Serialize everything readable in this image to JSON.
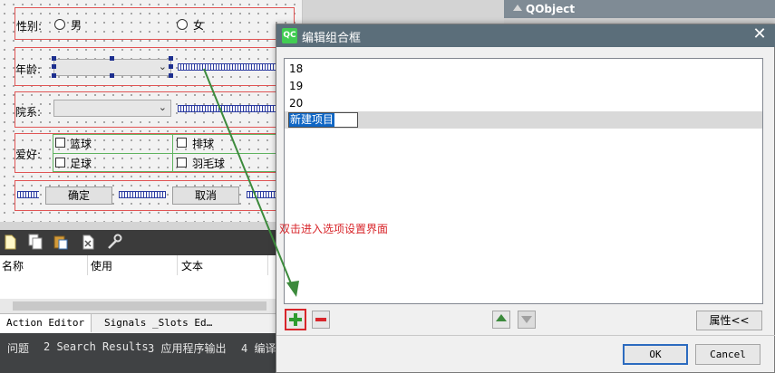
{
  "designer_form": {
    "gender_label": "性别:",
    "gender_male": "男",
    "gender_female": "女",
    "age_label": "年龄:",
    "department_label": "院系:",
    "hobby_label": "爱好:",
    "hobbies": [
      "篮球",
      "排球",
      "足球",
      "羽毛球"
    ],
    "confirm_button": "确定",
    "cancel_button": "取消"
  },
  "right_panel": {
    "object_row": "QObject"
  },
  "action_editor": {
    "columns": [
      "名称",
      "使用",
      "文本"
    ],
    "tabs": [
      "Action Editor",
      "Signals _Slots Ed…"
    ]
  },
  "status_bar": {
    "items": [
      "问题",
      "2 Search Results",
      "3 应用程序输出",
      "4 编译"
    ]
  },
  "dialog": {
    "app_badge": "QC",
    "title": "编辑组合框",
    "items": [
      "18",
      "19",
      "20"
    ],
    "editing_item": "新建项目",
    "properties_button": "属性<<",
    "ok_button": "OK",
    "cancel_button": "Cancel",
    "close_symbol": "✕"
  },
  "annotation": {
    "text": "双击进入选项设置界面",
    "color": "#d8262b"
  },
  "colors": {
    "accent": "#2c6bbf",
    "selection": "#0f66c4",
    "add_green": "#2e9b2e",
    "highlight_red": "#d8262b",
    "arrow_green": "#3c8a3c"
  },
  "icons": [
    "new-file-icon",
    "copy-icon",
    "paste-icon",
    "delete-icon",
    "wrench-icon",
    "qt-creator-icon",
    "close-icon",
    "add-icon",
    "remove-icon",
    "move-up-icon",
    "move-down-icon"
  ]
}
